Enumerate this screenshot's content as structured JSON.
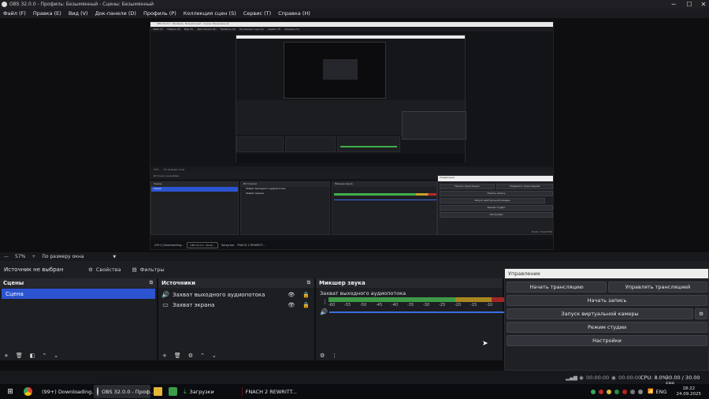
{
  "window": {
    "title": "OBS 32.0.0 - Профиль: Безымянный - Сцены: Безымянный"
  },
  "menu": [
    "Файл (F)",
    "Правка (E)",
    "Вид (V)",
    "Док-панели (D)",
    "Профиль (P)",
    "Коллекция сцен (S)",
    "Сервис (T)",
    "Справка (H)"
  ],
  "zoom": {
    "value": "57%",
    "mode": "По размеру окна"
  },
  "source_bar": {
    "no_source": "Источник не выбран",
    "properties": "Свойства",
    "filters": "Фильтры"
  },
  "scenes": {
    "title": "Сцены",
    "items": [
      "Сцена"
    ]
  },
  "sources": {
    "title": "Источники",
    "items": [
      "Захват выходного аудиопотока",
      "Захват экрана"
    ]
  },
  "mixer": {
    "title": "Микшер звука",
    "track": "Захват выходного аудиопотока",
    "scale": [
      "-60",
      "-55",
      "-50",
      "-45",
      "-40",
      "-35",
      "-30",
      "-25",
      "-20",
      "-15",
      "-10"
    ]
  },
  "controls": {
    "title": "Управление",
    "start_stream": "Начать трансляцию",
    "manage_stream": "Управлять трансляцией",
    "start_record": "Начать запись",
    "virtual_cam": "Запуск виртуальной камеры",
    "studio_mode": "Режим студии",
    "settings": "Настройки"
  },
  "status": {
    "stream_time": "00:00:00",
    "rec_time": "00:00:00",
    "cpu": "CPU: 8.0%",
    "fps": "30.00 / 30.00 FPS"
  },
  "taskbar": {
    "apps": [
      "(99+) Downloading...",
      "OBS 32.0.0 - Проф...",
      "Загрузки",
      "FNACH 2 REWRITT..."
    ],
    "lang": "ENG",
    "time": "18:22",
    "date": "24.09.2025"
  },
  "nested": {
    "title": "OBS 32.0.0 - Профиль: Безымянный - Сцены: Безымянный",
    "zoom": "37%",
    "fit": "По размеру окна",
    "control_title": "Управление",
    "start_stream": "Начать трансляцию",
    "manage_stream": "Управлять трансляцией",
    "start_record": "Начать запись",
    "virtual_cam": "Запуск виртуальной камеры",
    "studio_mode": "Режим студии",
    "settings": "Настройки",
    "scenes": "Сцены",
    "sources": "Источники",
    "mixer": "Микшер звука",
    "scene_item": "Сцена",
    "src1": "Захват выходного аудиопотока",
    "src2": "Захват экрана",
    "no_source": "Источник не выбран",
    "stats": "30.00 / 30.00 FPS"
  },
  "colors": {
    "accent": "#2c54d1",
    "meter_green": "#4caf50",
    "meter_yellow": "#c9a227",
    "meter_red": "#b82828"
  }
}
